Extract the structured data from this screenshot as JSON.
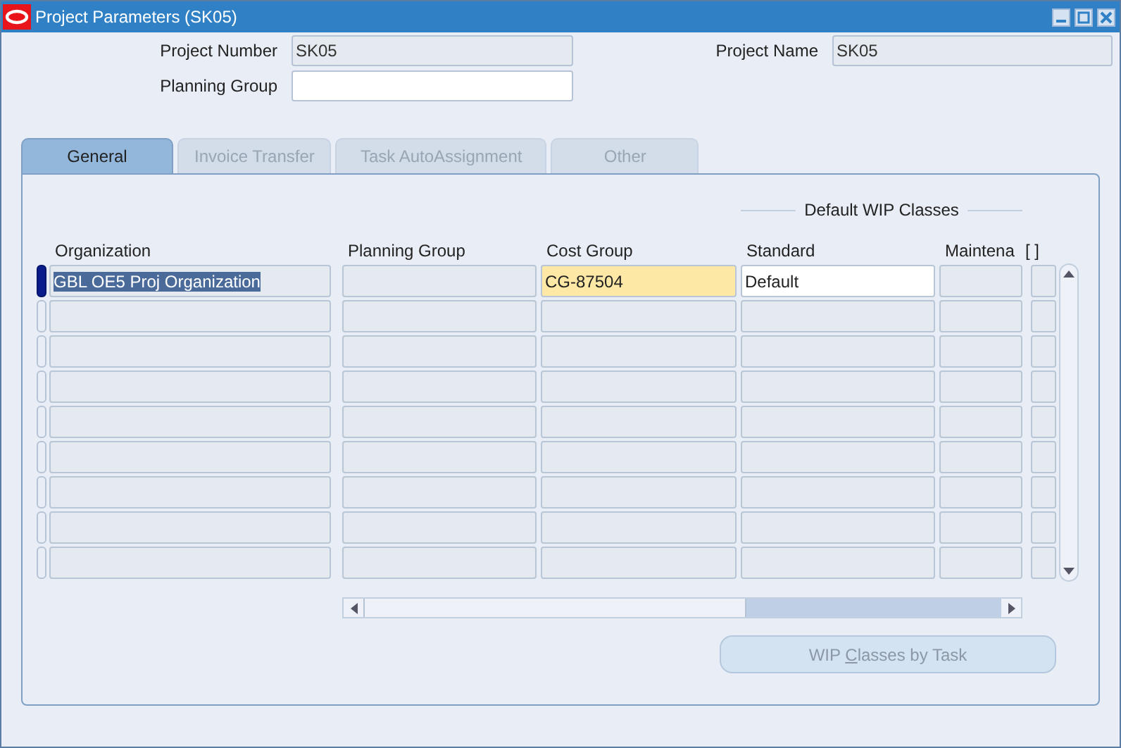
{
  "window": {
    "title": "Project Parameters (SK05)"
  },
  "header": {
    "project_number": {
      "label": "Project Number",
      "value": "SK05"
    },
    "project_name": {
      "label": "Project Name",
      "value": "SK05"
    },
    "planning_group": {
      "label": "Planning Group"
    }
  },
  "tabs": [
    {
      "label": "General",
      "selected": true,
      "disabled": false
    },
    {
      "label": "Invoice Transfer",
      "selected": false,
      "disabled": true
    },
    {
      "label": "Task AutoAssignment",
      "selected": false,
      "disabled": true
    },
    {
      "label": "Other",
      "selected": false,
      "disabled": true
    }
  ],
  "group_title": "Default WIP Classes",
  "table": {
    "columns": [
      "Organization",
      "Planning Group",
      "Cost Group",
      "Standard",
      "Maintena",
      "[ ]"
    ],
    "rows": [
      {
        "current": true,
        "cells": [
          {
            "kind": "readonly",
            "value": "GBL OE5 Proj Organization",
            "text_selected": true
          },
          {
            "kind": "readonly"
          },
          {
            "kind": "required",
            "value": "CG-87504"
          },
          {
            "kind": "editable",
            "value": "Default"
          },
          {
            "kind": "readonly"
          },
          {
            "kind": "readonly"
          }
        ]
      },
      {
        "current": false,
        "cells": [
          {
            "kind": "readonly"
          },
          {
            "kind": "readonly"
          },
          {
            "kind": "readonly"
          },
          {
            "kind": "readonly"
          },
          {
            "kind": "readonly"
          },
          {
            "kind": "readonly"
          }
        ]
      },
      {
        "current": false,
        "cells": [
          {
            "kind": "readonly"
          },
          {
            "kind": "readonly"
          },
          {
            "kind": "readonly"
          },
          {
            "kind": "readonly"
          },
          {
            "kind": "readonly"
          },
          {
            "kind": "readonly"
          }
        ]
      },
      {
        "current": false,
        "cells": [
          {
            "kind": "readonly"
          },
          {
            "kind": "readonly"
          },
          {
            "kind": "readonly"
          },
          {
            "kind": "readonly"
          },
          {
            "kind": "readonly"
          },
          {
            "kind": "readonly"
          }
        ]
      },
      {
        "current": false,
        "cells": [
          {
            "kind": "readonly"
          },
          {
            "kind": "readonly"
          },
          {
            "kind": "readonly"
          },
          {
            "kind": "readonly"
          },
          {
            "kind": "readonly"
          },
          {
            "kind": "readonly"
          }
        ]
      },
      {
        "current": false,
        "cells": [
          {
            "kind": "readonly"
          },
          {
            "kind": "readonly"
          },
          {
            "kind": "readonly"
          },
          {
            "kind": "readonly"
          },
          {
            "kind": "readonly"
          },
          {
            "kind": "readonly"
          }
        ]
      },
      {
        "current": false,
        "cells": [
          {
            "kind": "readonly"
          },
          {
            "kind": "readonly"
          },
          {
            "kind": "readonly"
          },
          {
            "kind": "readonly"
          },
          {
            "kind": "readonly"
          },
          {
            "kind": "readonly"
          }
        ]
      },
      {
        "current": false,
        "cells": [
          {
            "kind": "readonly"
          },
          {
            "kind": "readonly"
          },
          {
            "kind": "readonly"
          },
          {
            "kind": "readonly"
          },
          {
            "kind": "readonly"
          },
          {
            "kind": "readonly"
          }
        ]
      },
      {
        "current": false,
        "cells": [
          {
            "kind": "readonly"
          },
          {
            "kind": "readonly"
          },
          {
            "kind": "readonly"
          },
          {
            "kind": "readonly"
          },
          {
            "kind": "readonly"
          },
          {
            "kind": "readonly"
          }
        ]
      }
    ]
  },
  "button": {
    "label_parts": [
      "WIP ",
      "C",
      "lasses by Task"
    ],
    "disabled": true
  }
}
